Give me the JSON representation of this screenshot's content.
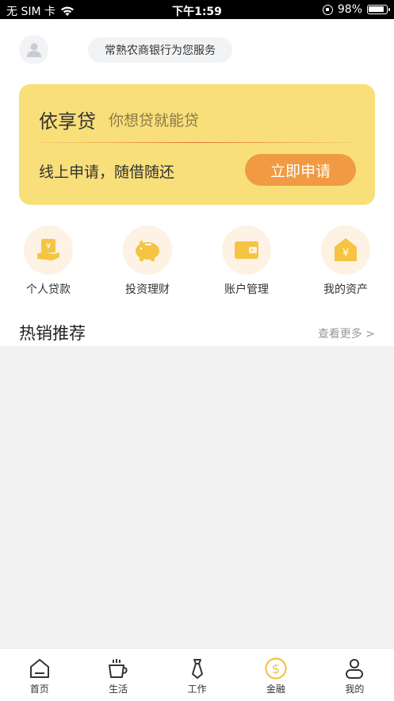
{
  "status_bar": {
    "carrier": "无 SIM 卡",
    "time": "下午1:59",
    "battery": "98%"
  },
  "header": {
    "service_text": "常熟农商银行为您服务"
  },
  "loan_card": {
    "title": "依享贷",
    "slogan": "你想贷就能贷",
    "description": "线上申请，随借随还",
    "apply_label": "立即申请"
  },
  "quick_menu": [
    {
      "label": "个人贷款",
      "icon": "loan-icon"
    },
    {
      "label": "投资理财",
      "icon": "piggy-bank-icon"
    },
    {
      "label": "账户管理",
      "icon": "wallet-icon"
    },
    {
      "label": "我的资产",
      "icon": "asset-icon"
    }
  ],
  "section": {
    "title": "热销推荐",
    "more_label": "查看更多 >"
  },
  "tabs": [
    {
      "label": "首页",
      "icon": "home-icon"
    },
    {
      "label": "生活",
      "icon": "coffee-cup-icon"
    },
    {
      "label": "工作",
      "icon": "tie-icon"
    },
    {
      "label": "金融",
      "icon": "dollar-coin-icon",
      "active": true
    },
    {
      "label": "我的",
      "icon": "person-icon"
    }
  ],
  "colors": {
    "card_bg": "#f8df7a",
    "accent_orange": "#f09b43",
    "icon_yellow": "#f5c443",
    "icon_bg": "#fdf2e3",
    "active_tab": "#f5c443"
  }
}
